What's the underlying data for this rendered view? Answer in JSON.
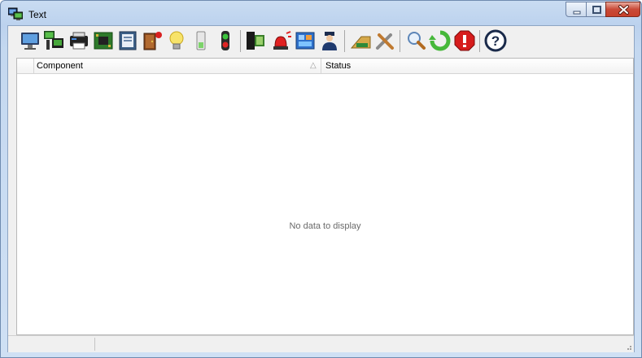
{
  "window": {
    "title": "Text"
  },
  "toolbar": {
    "buttons": [
      {
        "name": "computer-monitor-icon"
      },
      {
        "name": "network-computers-icon"
      },
      {
        "name": "printer-icon"
      },
      {
        "name": "circuit-board-icon"
      },
      {
        "name": "panel-module-icon"
      },
      {
        "name": "door-alarm-icon"
      },
      {
        "name": "light-bulb-icon"
      },
      {
        "name": "battery-icon"
      },
      {
        "name": "traffic-light-icon"
      },
      {
        "name": "server-rack-icon"
      },
      {
        "name": "siren-icon"
      },
      {
        "name": "floor-plan-icon"
      },
      {
        "name": "security-guard-icon"
      },
      {
        "name": "keyboard-card-icon"
      },
      {
        "name": "tools-icon"
      },
      {
        "name": "search-icon"
      },
      {
        "name": "refresh-icon"
      },
      {
        "name": "stop-icon"
      },
      {
        "name": "help-icon"
      }
    ]
  },
  "grid": {
    "columns": [
      {
        "label": "Component"
      },
      {
        "label": "Status"
      }
    ],
    "sort_indicator": "△",
    "empty_message": "No data to display"
  }
}
